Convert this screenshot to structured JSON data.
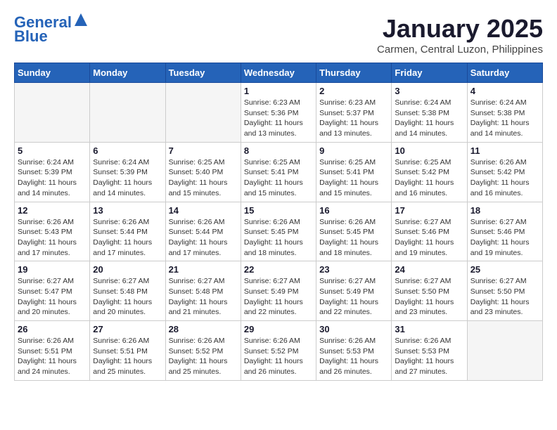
{
  "header": {
    "logo_line1": "General",
    "logo_line2": "Blue",
    "month_title": "January 2025",
    "location": "Carmen, Central Luzon, Philippines"
  },
  "days_of_week": [
    "Sunday",
    "Monday",
    "Tuesday",
    "Wednesday",
    "Thursday",
    "Friday",
    "Saturday"
  ],
  "weeks": [
    [
      {
        "day": "",
        "info": ""
      },
      {
        "day": "",
        "info": ""
      },
      {
        "day": "",
        "info": ""
      },
      {
        "day": "1",
        "info": "Sunrise: 6:23 AM\nSunset: 5:36 PM\nDaylight: 11 hours\nand 13 minutes."
      },
      {
        "day": "2",
        "info": "Sunrise: 6:23 AM\nSunset: 5:37 PM\nDaylight: 11 hours\nand 13 minutes."
      },
      {
        "day": "3",
        "info": "Sunrise: 6:24 AM\nSunset: 5:38 PM\nDaylight: 11 hours\nand 14 minutes."
      },
      {
        "day": "4",
        "info": "Sunrise: 6:24 AM\nSunset: 5:38 PM\nDaylight: 11 hours\nand 14 minutes."
      }
    ],
    [
      {
        "day": "5",
        "info": "Sunrise: 6:24 AM\nSunset: 5:39 PM\nDaylight: 11 hours\nand 14 minutes."
      },
      {
        "day": "6",
        "info": "Sunrise: 6:24 AM\nSunset: 5:39 PM\nDaylight: 11 hours\nand 14 minutes."
      },
      {
        "day": "7",
        "info": "Sunrise: 6:25 AM\nSunset: 5:40 PM\nDaylight: 11 hours\nand 15 minutes."
      },
      {
        "day": "8",
        "info": "Sunrise: 6:25 AM\nSunset: 5:41 PM\nDaylight: 11 hours\nand 15 minutes."
      },
      {
        "day": "9",
        "info": "Sunrise: 6:25 AM\nSunset: 5:41 PM\nDaylight: 11 hours\nand 15 minutes."
      },
      {
        "day": "10",
        "info": "Sunrise: 6:25 AM\nSunset: 5:42 PM\nDaylight: 11 hours\nand 16 minutes."
      },
      {
        "day": "11",
        "info": "Sunrise: 6:26 AM\nSunset: 5:42 PM\nDaylight: 11 hours\nand 16 minutes."
      }
    ],
    [
      {
        "day": "12",
        "info": "Sunrise: 6:26 AM\nSunset: 5:43 PM\nDaylight: 11 hours\nand 17 minutes."
      },
      {
        "day": "13",
        "info": "Sunrise: 6:26 AM\nSunset: 5:44 PM\nDaylight: 11 hours\nand 17 minutes."
      },
      {
        "day": "14",
        "info": "Sunrise: 6:26 AM\nSunset: 5:44 PM\nDaylight: 11 hours\nand 17 minutes."
      },
      {
        "day": "15",
        "info": "Sunrise: 6:26 AM\nSunset: 5:45 PM\nDaylight: 11 hours\nand 18 minutes."
      },
      {
        "day": "16",
        "info": "Sunrise: 6:26 AM\nSunset: 5:45 PM\nDaylight: 11 hours\nand 18 minutes."
      },
      {
        "day": "17",
        "info": "Sunrise: 6:27 AM\nSunset: 5:46 PM\nDaylight: 11 hours\nand 19 minutes."
      },
      {
        "day": "18",
        "info": "Sunrise: 6:27 AM\nSunset: 5:46 PM\nDaylight: 11 hours\nand 19 minutes."
      }
    ],
    [
      {
        "day": "19",
        "info": "Sunrise: 6:27 AM\nSunset: 5:47 PM\nDaylight: 11 hours\nand 20 minutes."
      },
      {
        "day": "20",
        "info": "Sunrise: 6:27 AM\nSunset: 5:48 PM\nDaylight: 11 hours\nand 20 minutes."
      },
      {
        "day": "21",
        "info": "Sunrise: 6:27 AM\nSunset: 5:48 PM\nDaylight: 11 hours\nand 21 minutes."
      },
      {
        "day": "22",
        "info": "Sunrise: 6:27 AM\nSunset: 5:49 PM\nDaylight: 11 hours\nand 22 minutes."
      },
      {
        "day": "23",
        "info": "Sunrise: 6:27 AM\nSunset: 5:49 PM\nDaylight: 11 hours\nand 22 minutes."
      },
      {
        "day": "24",
        "info": "Sunrise: 6:27 AM\nSunset: 5:50 PM\nDaylight: 11 hours\nand 23 minutes."
      },
      {
        "day": "25",
        "info": "Sunrise: 6:27 AM\nSunset: 5:50 PM\nDaylight: 11 hours\nand 23 minutes."
      }
    ],
    [
      {
        "day": "26",
        "info": "Sunrise: 6:26 AM\nSunset: 5:51 PM\nDaylight: 11 hours\nand 24 minutes."
      },
      {
        "day": "27",
        "info": "Sunrise: 6:26 AM\nSunset: 5:51 PM\nDaylight: 11 hours\nand 25 minutes."
      },
      {
        "day": "28",
        "info": "Sunrise: 6:26 AM\nSunset: 5:52 PM\nDaylight: 11 hours\nand 25 minutes."
      },
      {
        "day": "29",
        "info": "Sunrise: 6:26 AM\nSunset: 5:52 PM\nDaylight: 11 hours\nand 26 minutes."
      },
      {
        "day": "30",
        "info": "Sunrise: 6:26 AM\nSunset: 5:53 PM\nDaylight: 11 hours\nand 26 minutes."
      },
      {
        "day": "31",
        "info": "Sunrise: 6:26 AM\nSunset: 5:53 PM\nDaylight: 11 hours\nand 27 minutes."
      },
      {
        "day": "",
        "info": ""
      }
    ]
  ]
}
